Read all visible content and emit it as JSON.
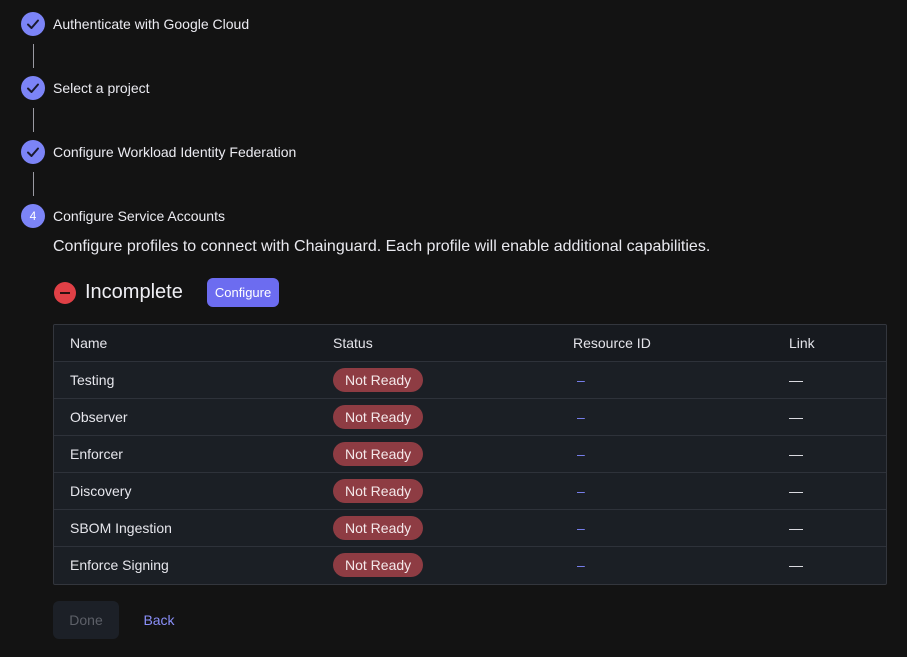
{
  "steps": [
    {
      "label": "Authenticate with Google Cloud",
      "state": "complete",
      "icon": "check-icon"
    },
    {
      "label": "Select a project",
      "state": "complete",
      "icon": "check-icon"
    },
    {
      "label": "Configure Workload Identity Federation",
      "state": "complete",
      "icon": "check-icon"
    },
    {
      "label": "Configure Service Accounts",
      "state": "active",
      "number": "4"
    }
  ],
  "description": "Configure profiles to connect with Chainguard. Each profile will enable additional capabilities.",
  "status": {
    "text": "Incomplete",
    "icon": "incomplete-icon",
    "configure_label": "Configure"
  },
  "table": {
    "columns": [
      "Name",
      "Status",
      "Resource ID",
      "Link"
    ],
    "rows": [
      {
        "name": "Testing",
        "status": "Not Ready",
        "resource_id": "–",
        "link": "—"
      },
      {
        "name": "Observer",
        "status": "Not Ready",
        "resource_id": "–",
        "link": "—"
      },
      {
        "name": "Enforcer",
        "status": "Not Ready",
        "resource_id": "–",
        "link": "—"
      },
      {
        "name": "Discovery",
        "status": "Not Ready",
        "resource_id": "–",
        "link": "—"
      },
      {
        "name": "SBOM Ingestion",
        "status": "Not Ready",
        "resource_id": "–",
        "link": "—"
      },
      {
        "name": "Enforce Signing",
        "status": "Not Ready",
        "resource_id": "–",
        "link": "—"
      }
    ]
  },
  "actions": {
    "done_label": "Done",
    "back_label": "Back"
  },
  "colors": {
    "accent": "#7c84f7",
    "button": "#6c6cf0",
    "not_ready": "#8e3c43",
    "incomplete": "#e04046"
  }
}
